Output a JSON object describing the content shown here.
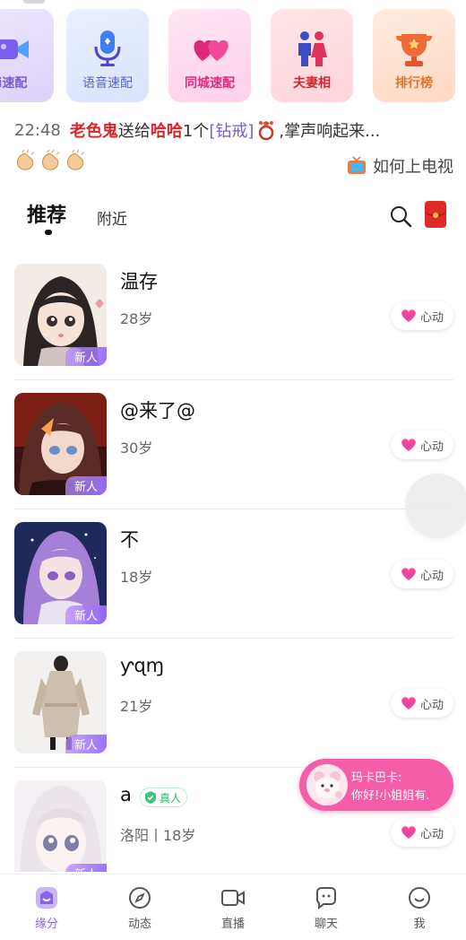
{
  "features": [
    {
      "label": "视频速配",
      "shown_label": "i速配",
      "icon": "video-icon",
      "color": "#7b5bd6"
    },
    {
      "label": "语音速配",
      "icon": "microphone-icon",
      "color": "#5567c9"
    },
    {
      "label": "同城速配",
      "icon": "hearts-icon",
      "color": "#e3297e"
    },
    {
      "label": "夫妻相",
      "icon": "couple-icon",
      "color": "#d4262d"
    },
    {
      "label": "排行榜",
      "icon": "trophy-icon",
      "color": "#e0742c"
    }
  ],
  "broadcast": {
    "time": "22:48",
    "sender": "老色鬼",
    "verb": "送给",
    "receiver": "哈哈",
    "count": "1个",
    "gift": "[钻戒]",
    "suffix": ",掌声响起来..."
  },
  "tv_link": "如何上电视",
  "tabs": {
    "recommend": "推荐",
    "nearby": "附近"
  },
  "users": [
    {
      "name": "温存",
      "meta": "28岁",
      "badge": "新人",
      "like": "心动"
    },
    {
      "name": "@来了@",
      "meta": "30岁",
      "badge": "新人",
      "like": "心动"
    },
    {
      "name": "不",
      "meta": "18岁",
      "badge": "新人",
      "like": "心动"
    },
    {
      "name": "ƴɋɱ",
      "meta": "21岁",
      "badge": "新人",
      "like": "心动"
    },
    {
      "name": "a",
      "meta": "洛阳丨18岁",
      "badge": "新人",
      "like": "心动",
      "verified": "真人"
    }
  ],
  "chat_popup": {
    "name": "玛卡巴卡:",
    "message": "你好!小姐姐有."
  },
  "nav": [
    {
      "label": "缘分",
      "icon": "fate-icon",
      "active": true
    },
    {
      "label": "动态",
      "icon": "compass-icon"
    },
    {
      "label": "直播",
      "icon": "camera-icon"
    },
    {
      "label": "聊天",
      "icon": "chat-icon"
    },
    {
      "label": "我",
      "icon": "smile-icon"
    }
  ],
  "colors": {
    "accent": "#8a63e8",
    "pink": "#f45ea8",
    "red": "#d4262d"
  }
}
